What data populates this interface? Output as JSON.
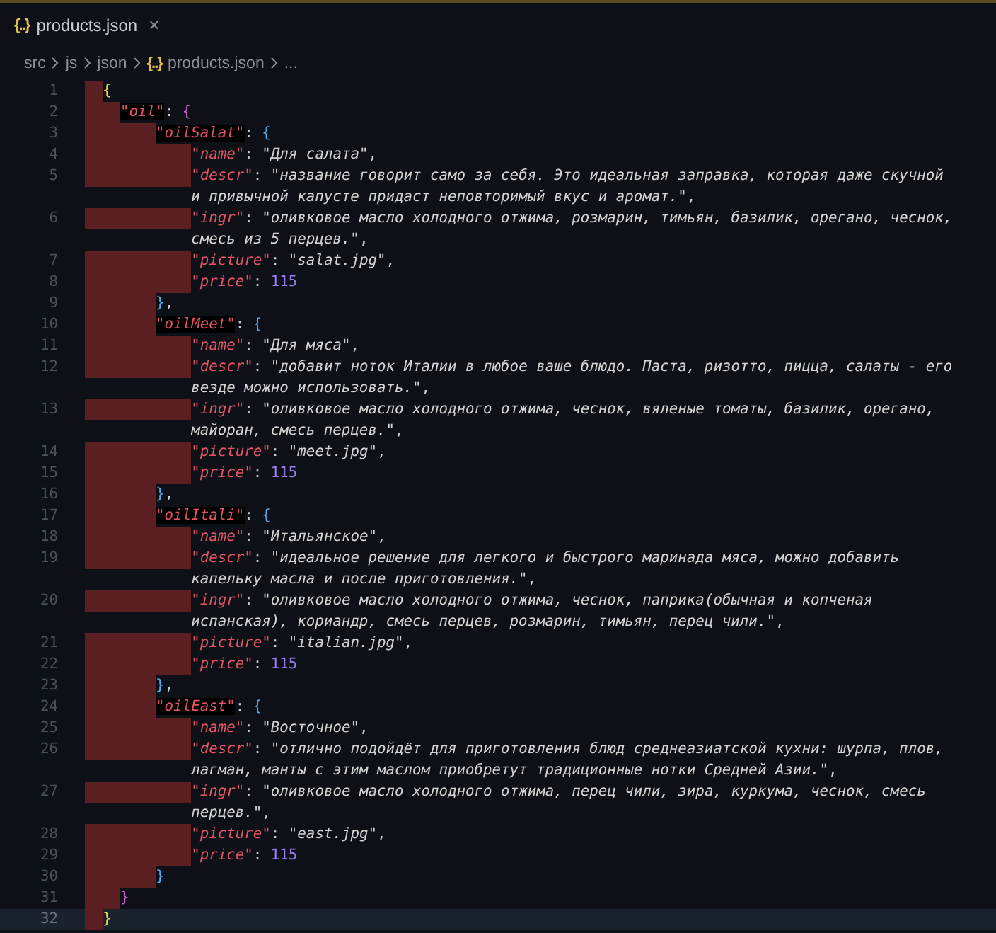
{
  "tab": {
    "icon": "{..}",
    "title": "products.json",
    "close": "×",
    "selected": true
  },
  "breadcrumb": {
    "items": [
      "src",
      "js",
      "json"
    ],
    "file_icon": "{..}",
    "file": "products.json",
    "more": "..."
  },
  "lines": [
    {
      "number": "1",
      "text": "  {",
      "current": false
    },
    {
      "number": "2",
      "text": "    \"oil\": {",
      "current": false
    },
    {
      "number": "3",
      "text": "        \"oilSalat\": {",
      "current": false
    },
    {
      "number": "4",
      "text": "            \"name\": \"Для салата\",",
      "current": false
    },
    {
      "number": "5",
      "text": "            \"descr\": \"название говорит само за себя. Это идеальная заправка, которая даже скучной и привычной капусте придаст неповторимый вкус и аромат.\",",
      "current": false
    },
    {
      "number": "6",
      "text": "            \"ingr\": \"оливковое масло холодного отжима, розмарин, тимьян, базилик, орегано, чеснок, смесь из 5 перцев.\",",
      "current": false
    },
    {
      "number": "7",
      "text": "            \"picture\": \"salat.jpg\",",
      "current": false
    },
    {
      "number": "8",
      "text": "            \"price\": 115",
      "current": false
    },
    {
      "number": "9",
      "text": "        },",
      "current": false
    },
    {
      "number": "10",
      "text": "        \"oilMeet\": {",
      "current": false
    },
    {
      "number": "11",
      "text": "            \"name\": \"Для мяса\",",
      "current": false
    },
    {
      "number": "12",
      "text": "            \"descr\": \"добавит ноток Италии в любое ваше блюдо. Паста, ризотто, пицца, салаты - его везде можно использовать.\",",
      "current": false
    },
    {
      "number": "13",
      "text": "            \"ingr\": \"оливковое масло холодного отжима, чеснок, вяленые томаты, базилик, орегано, майоран, смесь перцев.\",",
      "current": false
    },
    {
      "number": "14",
      "text": "            \"picture\": \"meet.jpg\",",
      "current": false
    },
    {
      "number": "15",
      "text": "            \"price\": 115",
      "current": false
    },
    {
      "number": "16",
      "text": "        },",
      "current": false
    },
    {
      "number": "17",
      "text": "        \"oilItali\": {",
      "current": false
    },
    {
      "number": "18",
      "text": "            \"name\": \"Итальянское\",",
      "current": false
    },
    {
      "number": "19",
      "text": "            \"descr\": \"идеальное решение для легкого и быстрого маринада мяса, можно добавить капельку масла и после приготовления.\",",
      "current": false
    },
    {
      "number": "20",
      "text": "            \"ingr\": \"оливковое масло холодного отжима, чеснок, паприка(обычная и копченая испанская), кориандр, смесь перцев, розмарин, тимьян, перец чили.\",",
      "current": false
    },
    {
      "number": "21",
      "text": "            \"picture\": \"italian.jpg\",",
      "current": false
    },
    {
      "number": "22",
      "text": "            \"price\": 115",
      "current": false
    },
    {
      "number": "23",
      "text": "        },",
      "current": false
    },
    {
      "number": "24",
      "text": "        \"oilEast\": {",
      "current": false
    },
    {
      "number": "25",
      "text": "            \"name\": \"Восточное\",",
      "current": false
    },
    {
      "number": "26",
      "text": "            \"descr\": \"отлично подойдёт для приготовления блюд среднеазиатской кухни: шурпа, плов, лагман, манты с этим маслом приобретут традиционные нотки Средней Азии.\",",
      "current": false
    },
    {
      "number": "27",
      "text": "            \"ingr\": \"оливковое масло холодного отжима, перец чили, зира, куркума, чеснок, смесь перцев.\",",
      "current": false
    },
    {
      "number": "28",
      "text": "            \"picture\": \"east.jpg\",",
      "current": false
    },
    {
      "number": "29",
      "text": "            \"price\": 115",
      "current": false
    },
    {
      "number": "30",
      "text": "        }",
      "current": false
    },
    {
      "number": "31",
      "text": "    }",
      "current": false
    },
    {
      "number": "32",
      "text": "  }",
      "current": true
    }
  ]
}
